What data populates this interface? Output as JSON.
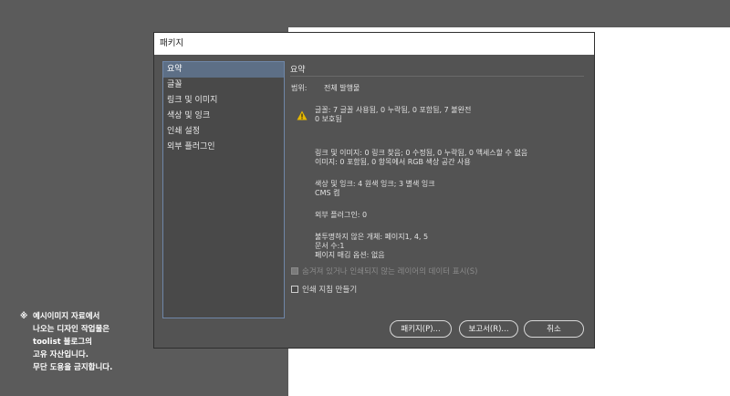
{
  "watermark": {
    "mark": "※",
    "line1": "예시이미지 자료에서",
    "line2": "나오는 디자인 작업물은",
    "line3": "toolist 블로그의",
    "line4": "고유 자산입니다.",
    "line5": "무단 도용을 금지합니다."
  },
  "dialog": {
    "title": "패키지",
    "nav": [
      "요약",
      "글꼴",
      "링크 및 이미지",
      "색상 및 잉크",
      "인쇄 설정",
      "외부 플러그인"
    ],
    "section_title": "요약",
    "range_label": "범위:",
    "range_value": "전체 발행물",
    "fonts_line1": "글꼴: 7 글꼴 사용됨, 0 누락됨, 0 포함됨, 7 불완전",
    "fonts_line2": "0 보호됨",
    "links_line1": "링크 및 이미지: 0 링크 찾음; 0 수정됨, 0 누락됨, 0 액세스할 수 없음",
    "links_line2": "이미지: 0 포함됨, 0 항목에서 RGB 색상 공간 사용",
    "colors_line1": "색상 및 잉크: 4 원색 잉크; 3 별색 잉크",
    "colors_line2": "CMS 켬",
    "plugins_line": "외부 플러그인: 0",
    "opaque_line1": "불투명하지 않은 개체: 페이지1, 4, 5",
    "opaque_line2": "문서 수:1",
    "opaque_line3": "페이지 매김 옵션: 없음",
    "checkbox_hidden_label": "숨겨져 있거나 인쇄되지 않는 레이어의 데이터 표시(S)",
    "checkbox_instructions_label": "인쇄 지침 만들기",
    "btn_package": "패키지(P)...",
    "btn_report": "보고서(R)...",
    "btn_cancel": "취소",
    "colors": {
      "selection": "#5d6f86",
      "warning": "#e6b800"
    }
  }
}
